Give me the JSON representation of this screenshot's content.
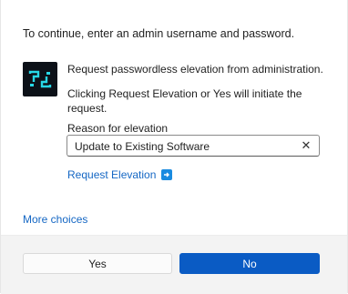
{
  "dialog": {
    "intro": "To continue, enter an admin username and password.",
    "request_text": "Request passwordless elevation from administration.",
    "note_text": "Clicking Request Elevation or Yes will initiate the request.",
    "reason_label": "Reason for elevation",
    "reason_value": "Update to Existing Software",
    "clear_glyph": "✕",
    "request_link": "Request Elevation",
    "more_choices": "More choices"
  },
  "footer": {
    "yes_label": "Yes",
    "no_label": "No"
  },
  "colors": {
    "accent": "#0a5bc4",
    "link": "#1567c4",
    "logo_bg": "#0c1118",
    "logo_fg": "#27d7e6"
  },
  "icons": {
    "logo": "app-logo-icon",
    "link_arrow": "arrow-right-box-icon",
    "clear": "close-icon"
  }
}
